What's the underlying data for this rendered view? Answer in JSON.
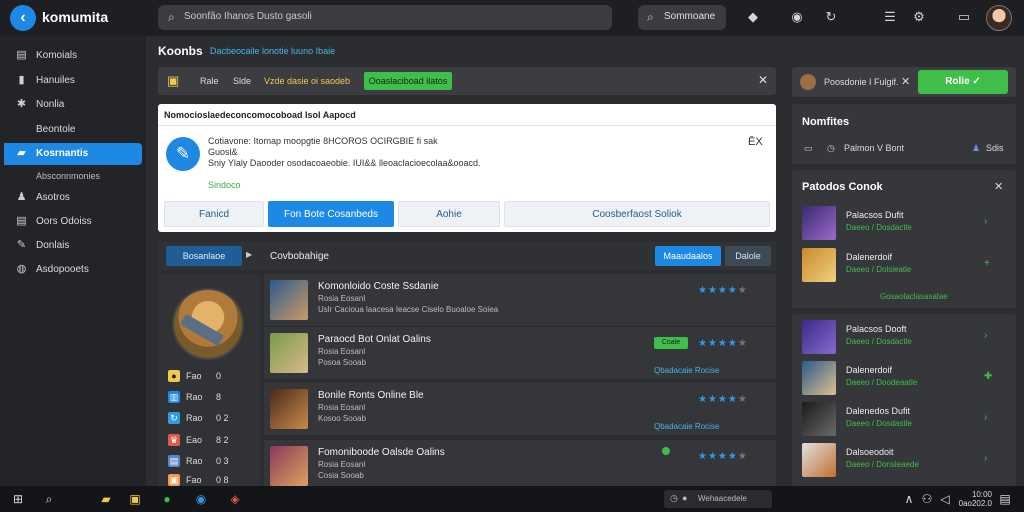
{
  "app": {
    "title": "komumita",
    "logo_icon": "back-arrow-icon"
  },
  "topbar": {
    "search_placeholder": "Soonfão Ihanos Dusto gasoli",
    "search2_label": "Sommoane",
    "icons": [
      "diamond-icon",
      "circle-icon",
      "refresh-icon",
      "list-icon",
      "gear-icon",
      "message-icon"
    ]
  },
  "sidebar": {
    "items": [
      {
        "label": "Komoials",
        "icon": "file-icon"
      },
      {
        "label": "Hanuiles",
        "icon": "bookmark-icon"
      },
      {
        "label": "Nonlia",
        "icon": "gear-icon"
      },
      {
        "label": "Beontole",
        "icon": ""
      },
      {
        "label": "Kosrnantis",
        "icon": "folder-icon",
        "active": true
      },
      {
        "label": "Absconnmonies",
        "icon": ""
      },
      {
        "label": "Asotros",
        "icon": "users-icon"
      },
      {
        "label": "Oors Odoiss",
        "icon": "file-icon"
      },
      {
        "label": "Donlais",
        "icon": "edit-icon"
      },
      {
        "label": "Asdopooets",
        "icon": "chart-icon"
      }
    ]
  },
  "main": {
    "title": "Koonbs",
    "subtitle": "Dacbeocaile lonotie luuno Ibaie"
  },
  "notif_bar": {
    "t1": "Rale",
    "t2": "Slde",
    "t3": "Vzde dasie oi saodeb",
    "button": "Ooaslaciboad ilatos"
  },
  "dialog": {
    "header": "Nomocioslaedeconcomocoboad Isol Aapocd",
    "line1": "Cotiavone: Itomap moopgtie 8HCOROS OCIRGBIE  fi sak",
    "line2": "Guosl&",
    "line3": "Sniy Ylaly Daooder osodacoaeobie. IUI&& lleoaclacioecolaa&ooacd.",
    "green": "Sindoco",
    "close": "ĒX",
    "buttons": [
      "Fanicd",
      "Fon Bote Cosanbeds",
      "Aohie",
      "Coosberfaost Soliok"
    ]
  },
  "section": {
    "dropdown": "Bosanlaoe",
    "label": "Covbobahige",
    "btn1": "Maaudaalos",
    "btn2": "Dalole"
  },
  "profile": {
    "stats": [
      {
        "k": "Fao",
        "v": "0",
        "icon": "coin-icon"
      },
      {
        "k": "Rao",
        "v": "8",
        "icon": "chart-icon"
      },
      {
        "k": "Rao",
        "v": "0 2",
        "icon": "refresh-icon"
      },
      {
        "k": "Eao",
        "v": "8 2",
        "icon": "trophy-icon"
      },
      {
        "k": "Rao",
        "v": "0 3",
        "icon": "list-icon"
      },
      {
        "k": "Fao",
        "v": "0 8",
        "icon": "gift-icon"
      }
    ]
  },
  "list": [
    {
      "title": "Komonloido Coste Ssdanie",
      "meta": "Rosia Eosanl",
      "desc": "Uslr Cacioua laacesa Ieacse Ciselo Buoaloe Soiea",
      "rating": 4,
      "badge": "",
      "link": ""
    },
    {
      "title": "Paraocd Bot Onlat Oalins",
      "meta": "Rosia Eosanl",
      "desc": "Posoa Sooab",
      "rating": 4,
      "badge": "Coale",
      "link": "Qbadacaie Rocise"
    },
    {
      "title": "Bonile Ronts Online Ble",
      "meta": "Rosia Eosanl",
      "desc": "Kosoo Sooab",
      "rating": 4,
      "badge": "",
      "link": "Qbadacaie Rocise"
    },
    {
      "title": "Fomoniboode Oalsde Oalins",
      "meta": "Rosia Eosanl",
      "desc": "Cosia Sooab",
      "rating": 4,
      "badge": "",
      "link": ""
    }
  ],
  "right": {
    "top_text": "Poosdonie I Fulgif.",
    "top_button": "Rolie",
    "panel1": {
      "title": "Nomfites",
      "text": "Palmon V Bont",
      "link": "Sdis"
    },
    "panel2": {
      "title": "Patodos Conok",
      "items": [
        {
          "name": "Palacsos Dufit",
          "sub": "Daeeo / Dosdactle"
        },
        {
          "name": "Dalenerdoif",
          "sub": "Daeeo / Dolsieatle"
        }
      ],
      "footer": "Gosaolaclasasalae"
    },
    "panel3": {
      "items": [
        {
          "name": "Palacsos Dooft",
          "sub": "Daeeo / Dosdactle"
        },
        {
          "name": "Dalenerdoif",
          "sub": "Daeeo / Doodeaatle"
        },
        {
          "name": "Dalenedos Dufit",
          "sub": "Daeeo / Dosdastle"
        },
        {
          "name": "Dalsoeodoit",
          "sub": "Daeeo / Donsleaede"
        }
      ]
    }
  },
  "taskbar": {
    "search": "Wehaacedele",
    "time": "10:00",
    "date": "0ao202.0"
  }
}
